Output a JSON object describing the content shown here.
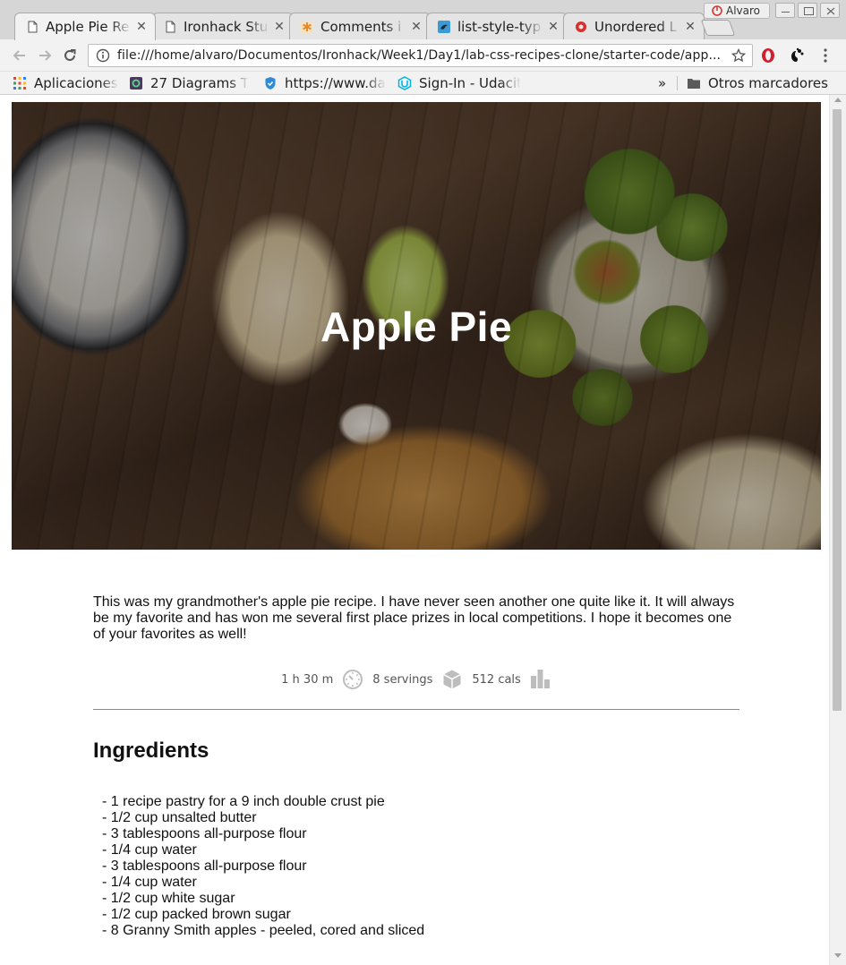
{
  "browser": {
    "tabs": [
      {
        "title": "Apple Pie Re",
        "active": true,
        "icon": "document-icon"
      },
      {
        "title": "Ironhack Stu",
        "active": false,
        "icon": "document-icon"
      },
      {
        "title": "Comments i",
        "active": false,
        "icon": "asterisk-icon"
      },
      {
        "title": "list-style-typ",
        "active": false,
        "icon": "bird-icon"
      },
      {
        "title": "Unordered L",
        "active": false,
        "icon": "record-icon"
      }
    ],
    "profile_name": "Alvaro",
    "url": "file:///home/alvaro/Documentos/Ironhack/Week1/Day1/lab-css-recipes-clone/starter-code/app...",
    "bookmarks": [
      {
        "label": "Aplicaciones",
        "icon": "apps-grid-icon"
      },
      {
        "label": "27 Diagrams T",
        "icon": "diagram-icon"
      },
      {
        "label": "https://www.da",
        "icon": "shield-icon"
      },
      {
        "label": "Sign-In - Udacit",
        "icon": "udacity-icon"
      }
    ],
    "bookmarks_overflow": "»",
    "other_bookmarks": "Otros marcadores"
  },
  "page": {
    "hero_title": "Apple Pie",
    "intro": "This was my grandmother's apple pie recipe. I have never seen another one quite like it. It will always be my favorite and has won me several first place prizes in local competitions. I hope it becomes one of your favorites as well!",
    "stats": {
      "time": "1 h 30 m",
      "servings": "8 servings",
      "calories": "512 cals"
    },
    "ingredients_title": "Ingredients",
    "ingredients": [
      "- 1 recipe pastry for a 9 inch double crust pie",
      "- 1/2 cup unsalted butter",
      "- 3 tablespoons all-purpose flour",
      "- 1/4 cup water",
      "- 3 tablespoons all-purpose flour",
      "- 1/4 cup water",
      "- 1/2 cup white sugar",
      "- 1/2 cup packed brown sugar",
      "- 8 Granny Smith apples - peeled, cored and sliced"
    ]
  },
  "colors": {
    "stat_icon": "#bdbdbd",
    "stat_text": "#555555",
    "divider": "#8a8a8a"
  }
}
